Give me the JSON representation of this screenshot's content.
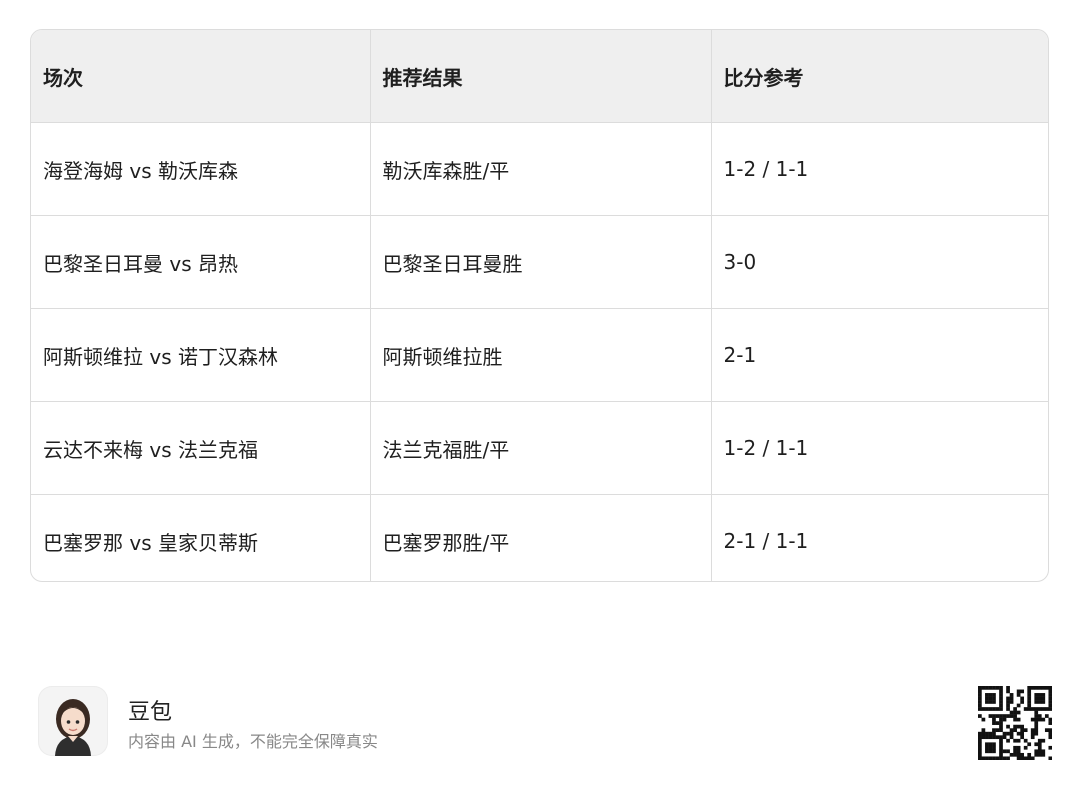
{
  "table": {
    "headers": [
      "场次",
      "推荐结果",
      "比分参考"
    ],
    "rows": [
      [
        "海登海姆 vs 勒沃库森",
        "勒沃库森胜/平",
        "1-2 / 1-1"
      ],
      [
        "巴黎圣日耳曼 vs 昂热",
        "巴黎圣日耳曼胜",
        "3-0"
      ],
      [
        "阿斯顿维拉 vs 诺丁汉森林",
        "阿斯顿维拉胜",
        "2-1"
      ],
      [
        "云达不来梅 vs 法兰克福",
        "法兰克福胜/平",
        "1-2 / 1-1"
      ],
      [
        "巴塞罗那 vs 皇家贝蒂斯",
        "巴塞罗那胜/平",
        "2-1 / 1-1"
      ]
    ]
  },
  "footer": {
    "app_name": "豆包",
    "disclaimer": "内容由 AI 生成，不能完全保障真实",
    "avatar_icon": "assistant-avatar-icon",
    "qr_icon": "qr-code-icon"
  }
}
